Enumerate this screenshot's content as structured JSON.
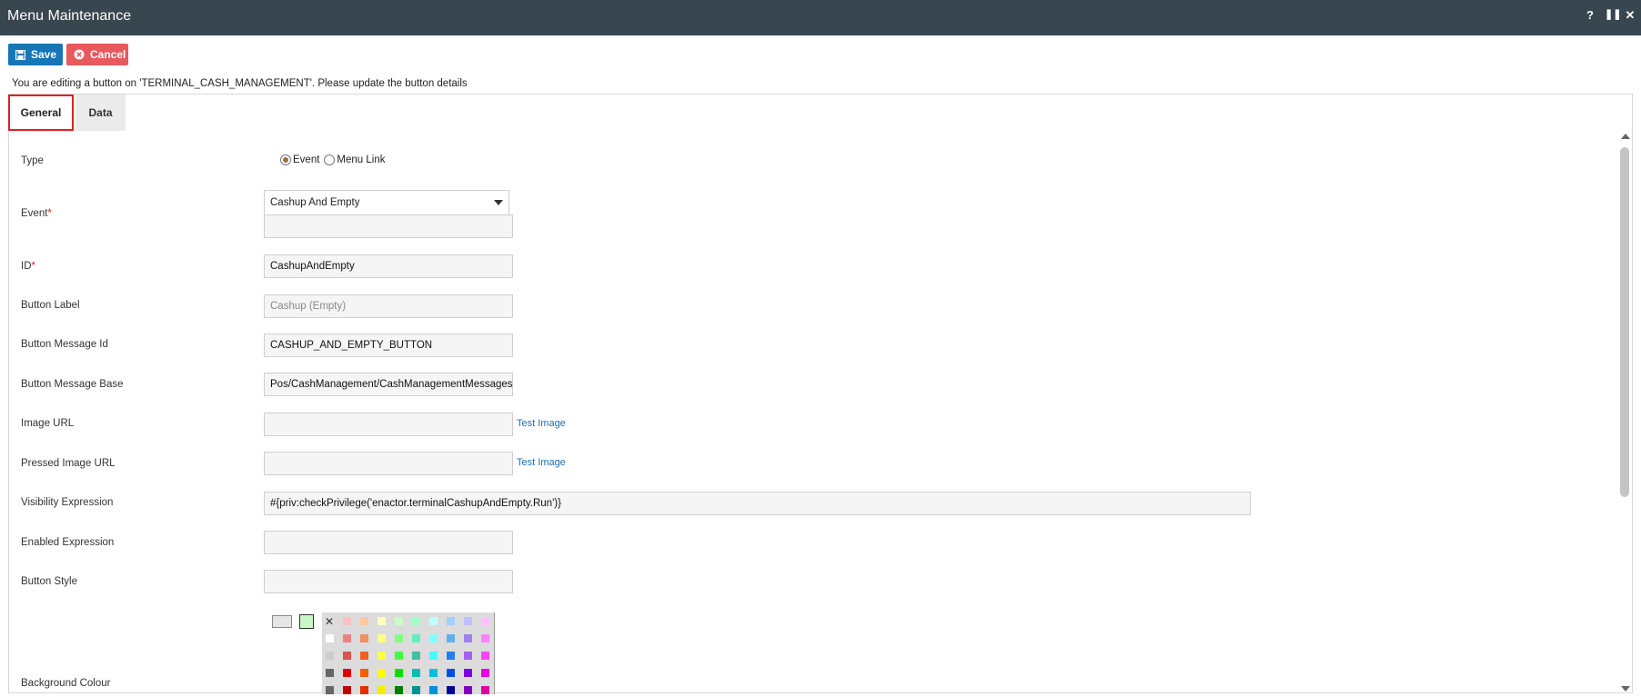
{
  "window": {
    "title": "Menu Maintenance",
    "controls": {
      "help": "?",
      "pause": "⏸",
      "close": "✕"
    }
  },
  "toolbar": {
    "save_label": "Save",
    "cancel_label": "Cancel"
  },
  "notice": "You are editing a button on 'TERMINAL_CASH_MANAGEMENT'. Please update the button details",
  "tabs": [
    {
      "label": "General",
      "active": true
    },
    {
      "label": "Data",
      "active": false
    }
  ],
  "form": {
    "type": {
      "label": "Type",
      "options": [
        "Event",
        "Menu Link"
      ],
      "selected": "Event"
    },
    "event": {
      "label": "Event",
      "required_marker": "*",
      "selected": "Cashup And Empty",
      "secondary_value": ""
    },
    "id": {
      "label": "ID",
      "required_marker": "*",
      "value": "CashupAndEmpty"
    },
    "button_label": {
      "label": "Button Label",
      "placeholder": "Cashup (Empty)"
    },
    "button_message_id": {
      "label": "Button Message Id",
      "value": "CASHUP_AND_EMPTY_BUTTON"
    },
    "button_message_base": {
      "label": "Button Message Base",
      "value": "Pos/CashManagement/CashManagementMessages"
    },
    "image_url": {
      "label": "Image URL",
      "value": "",
      "test_link": "Test Image"
    },
    "pressed_image_url": {
      "label": "Pressed Image URL",
      "value": "",
      "test_link": "Test Image"
    },
    "visibility_expression": {
      "label": "Visibility Expression",
      "value": "#{priv:checkPrivilege('enactor.terminalCashupAndEmpty.Run')}"
    },
    "enabled_expression": {
      "label": "Enabled Expression",
      "value": ""
    },
    "button_style": {
      "label": "Button Style",
      "value": ""
    },
    "background_colour": {
      "label": "Background Colour",
      "current_colors": [
        "#e6e6e6",
        "#c8f7c8"
      ],
      "palette_columns": [
        [
          "#ffffff",
          "#ffffff",
          "#cccccc",
          "#666666",
          "#666666"
        ],
        [
          "#ffc0c0",
          "#f08080",
          "#e05050",
          "#e00000",
          "#c00000"
        ],
        [
          "#ffc8a0",
          "#f09060",
          "#f06020",
          "#f06000",
          "#e03000"
        ],
        [
          "#ffffc0",
          "#ffff80",
          "#ffff40",
          "#ffff00",
          "#f0f000"
        ],
        [
          "#c8ffc8",
          "#80ff80",
          "#40ff40",
          "#00e000",
          "#008000"
        ],
        [
          "#a0ffc8",
          "#60f0c0",
          "#40c0a0",
          "#00c0b0",
          "#009090"
        ],
        [
          "#c0ffff",
          "#80ffff",
          "#40ffff",
          "#00c0e0",
          "#0090e0"
        ],
        [
          "#a0d0ff",
          "#60b0f0",
          "#2080f0",
          "#0050e0",
          "#0000a0"
        ],
        [
          "#c0c0ff",
          "#a080f0",
          "#a060f0",
          "#8000e0",
          "#8000c0"
        ],
        [
          "#ffc0ff",
          "#ff80ff",
          "#ff40ff",
          "#e000e0",
          "#e000a0"
        ]
      ]
    }
  }
}
